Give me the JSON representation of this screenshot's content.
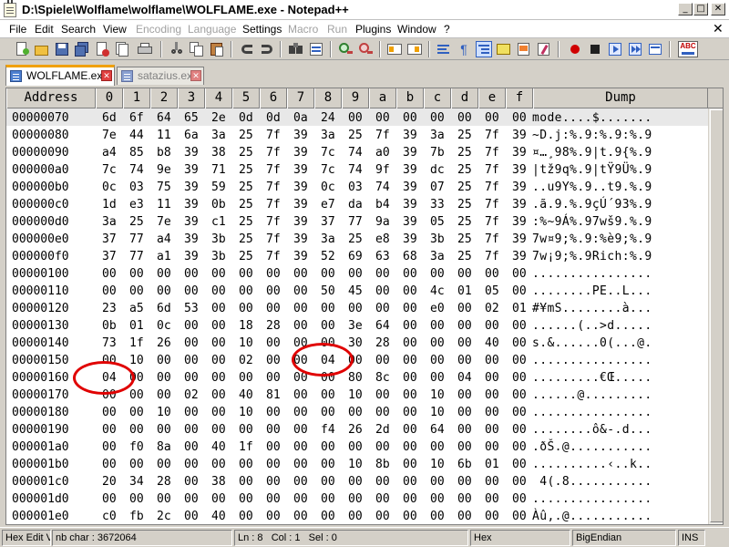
{
  "window": {
    "title": "D:\\Spiele\\Wolflame\\wolflame\\WOLFLAME.exe - Notepad++",
    "minimize": "_",
    "maximize": "□",
    "close": "✕"
  },
  "menu": {
    "items": [
      "File",
      "Edit",
      "Search",
      "View",
      "Encoding",
      "Language",
      "Settings",
      "Macro",
      "Run",
      "Plugins",
      "Window",
      "?"
    ],
    "close_x": "✕"
  },
  "toolbar": {
    "icons": [
      "new-file-icon",
      "open-file-icon",
      "save-icon",
      "save-all-icon",
      "close-file-icon",
      "print-icon",
      "cut-icon",
      "copy-icon",
      "paste-icon",
      "undo-icon",
      "redo-icon",
      "find-icon",
      "replace-icon",
      "zoom-in-icon",
      "zoom-out-icon",
      "sync-vertical-icon",
      "sync-horizontal-icon",
      "word-wrap-icon",
      "show-all-chars-icon",
      "indent-guide-icon",
      "user-language-icon",
      "doc-map-icon",
      "function-list-icon",
      "record-macro-icon",
      "stop-record-icon",
      "playback-macro-icon",
      "run-macro-multiple-icon",
      "save-macro-icon",
      "spell-check-icon"
    ]
  },
  "tabs": [
    {
      "label": "WOLFLAME.exe",
      "active": true
    },
    {
      "label": "satazius.exe",
      "active": false
    }
  ],
  "hex": {
    "header": {
      "address": "Address",
      "columns": [
        "0",
        "1",
        "2",
        "3",
        "4",
        "5",
        "6",
        "7",
        "8",
        "9",
        "a",
        "b",
        "c",
        "d",
        "e",
        "f"
      ],
      "dump": "Dump"
    },
    "rows": [
      {
        "addr": "00000070",
        "bytes": [
          "6d",
          "6f",
          "64",
          "65",
          "2e",
          "0d",
          "0d",
          "0a",
          "24",
          "00",
          "00",
          "00",
          "00",
          "00",
          "00",
          "00"
        ],
        "dump": "mode....$......."
      },
      {
        "addr": "00000080",
        "bytes": [
          "7e",
          "44",
          "11",
          "6a",
          "3a",
          "25",
          "7f",
          "39",
          "3a",
          "25",
          "7f",
          "39",
          "3a",
          "25",
          "7f",
          "39"
        ],
        "dump": "~D.j:%.9:%.9:%.9"
      },
      {
        "addr": "00000090",
        "bytes": [
          "a4",
          "85",
          "b8",
          "39",
          "38",
          "25",
          "7f",
          "39",
          "7c",
          "74",
          "a0",
          "39",
          "7b",
          "25",
          "7f",
          "39"
        ],
        "dump": "¤…¸98%.9|t.9{%.9"
      },
      {
        "addr": "000000a0",
        "bytes": [
          "7c",
          "74",
          "9e",
          "39",
          "71",
          "25",
          "7f",
          "39",
          "7c",
          "74",
          "9f",
          "39",
          "dc",
          "25",
          "7f",
          "39"
        ],
        "dump": "|tž9q%.9|tŸ9Ü%.9"
      },
      {
        "addr": "000000b0",
        "bytes": [
          "0c",
          "03",
          "75",
          "39",
          "59",
          "25",
          "7f",
          "39",
          "0c",
          "03",
          "74",
          "39",
          "07",
          "25",
          "7f",
          "39"
        ],
        "dump": "..u9Y%.9..t9.%.9"
      },
      {
        "addr": "000000c0",
        "bytes": [
          "1d",
          "e3",
          "11",
          "39",
          "0b",
          "25",
          "7f",
          "39",
          "e7",
          "da",
          "b4",
          "39",
          "33",
          "25",
          "7f",
          "39"
        ],
        "dump": ".ã.9.%.9çÚ´93%.9"
      },
      {
        "addr": "000000d0",
        "bytes": [
          "3a",
          "25",
          "7e",
          "39",
          "c1",
          "25",
          "7f",
          "39",
          "37",
          "77",
          "9a",
          "39",
          "05",
          "25",
          "7f",
          "39"
        ],
        "dump": ":%~9Á%.97wš9.%.9"
      },
      {
        "addr": "000000e0",
        "bytes": [
          "37",
          "77",
          "a4",
          "39",
          "3b",
          "25",
          "7f",
          "39",
          "3a",
          "25",
          "e8",
          "39",
          "3b",
          "25",
          "7f",
          "39"
        ],
        "dump": "7w¤9;%.9:%è9;%.9"
      },
      {
        "addr": "000000f0",
        "bytes": [
          "37",
          "77",
          "a1",
          "39",
          "3b",
          "25",
          "7f",
          "39",
          "52",
          "69",
          "63",
          "68",
          "3a",
          "25",
          "7f",
          "39"
        ],
        "dump": "7w¡9;%.9Rich:%.9"
      },
      {
        "addr": "00000100",
        "bytes": [
          "00",
          "00",
          "00",
          "00",
          "00",
          "00",
          "00",
          "00",
          "00",
          "00",
          "00",
          "00",
          "00",
          "00",
          "00",
          "00"
        ],
        "dump": "................"
      },
      {
        "addr": "00000110",
        "bytes": [
          "00",
          "00",
          "00",
          "00",
          "00",
          "00",
          "00",
          "00",
          "50",
          "45",
          "00",
          "00",
          "4c",
          "01",
          "05",
          "00"
        ],
        "dump": "........PE..L..."
      },
      {
        "addr": "00000120",
        "bytes": [
          "23",
          "a5",
          "6d",
          "53",
          "00",
          "00",
          "00",
          "00",
          "00",
          "00",
          "00",
          "00",
          "e0",
          "00",
          "02",
          "01"
        ],
        "dump": "#¥mS........à..."
      },
      {
        "addr": "00000130",
        "bytes": [
          "0b",
          "01",
          "0c",
          "00",
          "00",
          "18",
          "28",
          "00",
          "00",
          "3e",
          "64",
          "00",
          "00",
          "00",
          "00",
          "00"
        ],
        "dump": "......(..>d....."
      },
      {
        "addr": "00000140",
        "bytes": [
          "73",
          "1f",
          "26",
          "00",
          "00",
          "10",
          "00",
          "00",
          "00",
          "30",
          "28",
          "00",
          "00",
          "00",
          "40",
          "00"
        ],
        "dump": "s.&......0(...@."
      },
      {
        "addr": "00000150",
        "bytes": [
          "00",
          "10",
          "00",
          "00",
          "00",
          "02",
          "00",
          "00",
          "04",
          "00",
          "00",
          "00",
          "00",
          "00",
          "00",
          "00"
        ],
        "dump": "................"
      },
      {
        "addr": "00000160",
        "bytes": [
          "04",
          "00",
          "00",
          "00",
          "00",
          "00",
          "00",
          "00",
          "00",
          "80",
          "8c",
          "00",
          "00",
          "04",
          "00",
          "00"
        ],
        "dump": ".........€Œ....."
      },
      {
        "addr": "00000170",
        "bytes": [
          "00",
          "00",
          "00",
          "02",
          "00",
          "40",
          "81",
          "00",
          "00",
          "10",
          "00",
          "00",
          "10",
          "00",
          "00",
          "00"
        ],
        "dump": "......@........."
      },
      {
        "addr": "00000180",
        "bytes": [
          "00",
          "00",
          "10",
          "00",
          "00",
          "10",
          "00",
          "00",
          "00",
          "00",
          "00",
          "00",
          "10",
          "00",
          "00",
          "00"
        ],
        "dump": "................"
      },
      {
        "addr": "00000190",
        "bytes": [
          "00",
          "00",
          "00",
          "00",
          "00",
          "00",
          "00",
          "00",
          "f4",
          "26",
          "2d",
          "00",
          "64",
          "00",
          "00",
          "00"
        ],
        "dump": "........ô&-.d..."
      },
      {
        "addr": "000001a0",
        "bytes": [
          "00",
          "f0",
          "8a",
          "00",
          "40",
          "1f",
          "00",
          "00",
          "00",
          "00",
          "00",
          "00",
          "00",
          "00",
          "00",
          "00"
        ],
        "dump": ".ðŠ.@..........."
      },
      {
        "addr": "000001b0",
        "bytes": [
          "00",
          "00",
          "00",
          "00",
          "00",
          "00",
          "00",
          "00",
          "00",
          "10",
          "8b",
          "00",
          "10",
          "6b",
          "01",
          "00"
        ],
        "dump": "..........‹..k.."
      },
      {
        "addr": "000001c0",
        "bytes": [
          "20",
          "34",
          "28",
          "00",
          "38",
          "00",
          "00",
          "00",
          "00",
          "00",
          "00",
          "00",
          "00",
          "00",
          "00",
          "00"
        ],
        "dump": " 4(.8..........."
      },
      {
        "addr": "000001d0",
        "bytes": [
          "00",
          "00",
          "00",
          "00",
          "00",
          "00",
          "00",
          "00",
          "00",
          "00",
          "00",
          "00",
          "00",
          "00",
          "00",
          "00"
        ],
        "dump": "................"
      },
      {
        "addr": "000001e0",
        "bytes": [
          "c0",
          "fb",
          "2c",
          "00",
          "40",
          "00",
          "00",
          "00",
          "00",
          "00",
          "00",
          "00",
          "00",
          "00",
          "00",
          "00"
        ],
        "dump": "Àû,.@..........."
      }
    ]
  },
  "status": {
    "mode": "Hex Edit V",
    "nb_char": "nb char : 3672064",
    "position": "Ln : 8   Col : 1   Sel : 0",
    "hex": "Hex",
    "endian": "BigEndian",
    "ins": "INS"
  },
  "colors": {
    "annotation": "#e00000",
    "active_tab_accent": "#f0a000",
    "highlight_row": "#e8e8e8"
  }
}
